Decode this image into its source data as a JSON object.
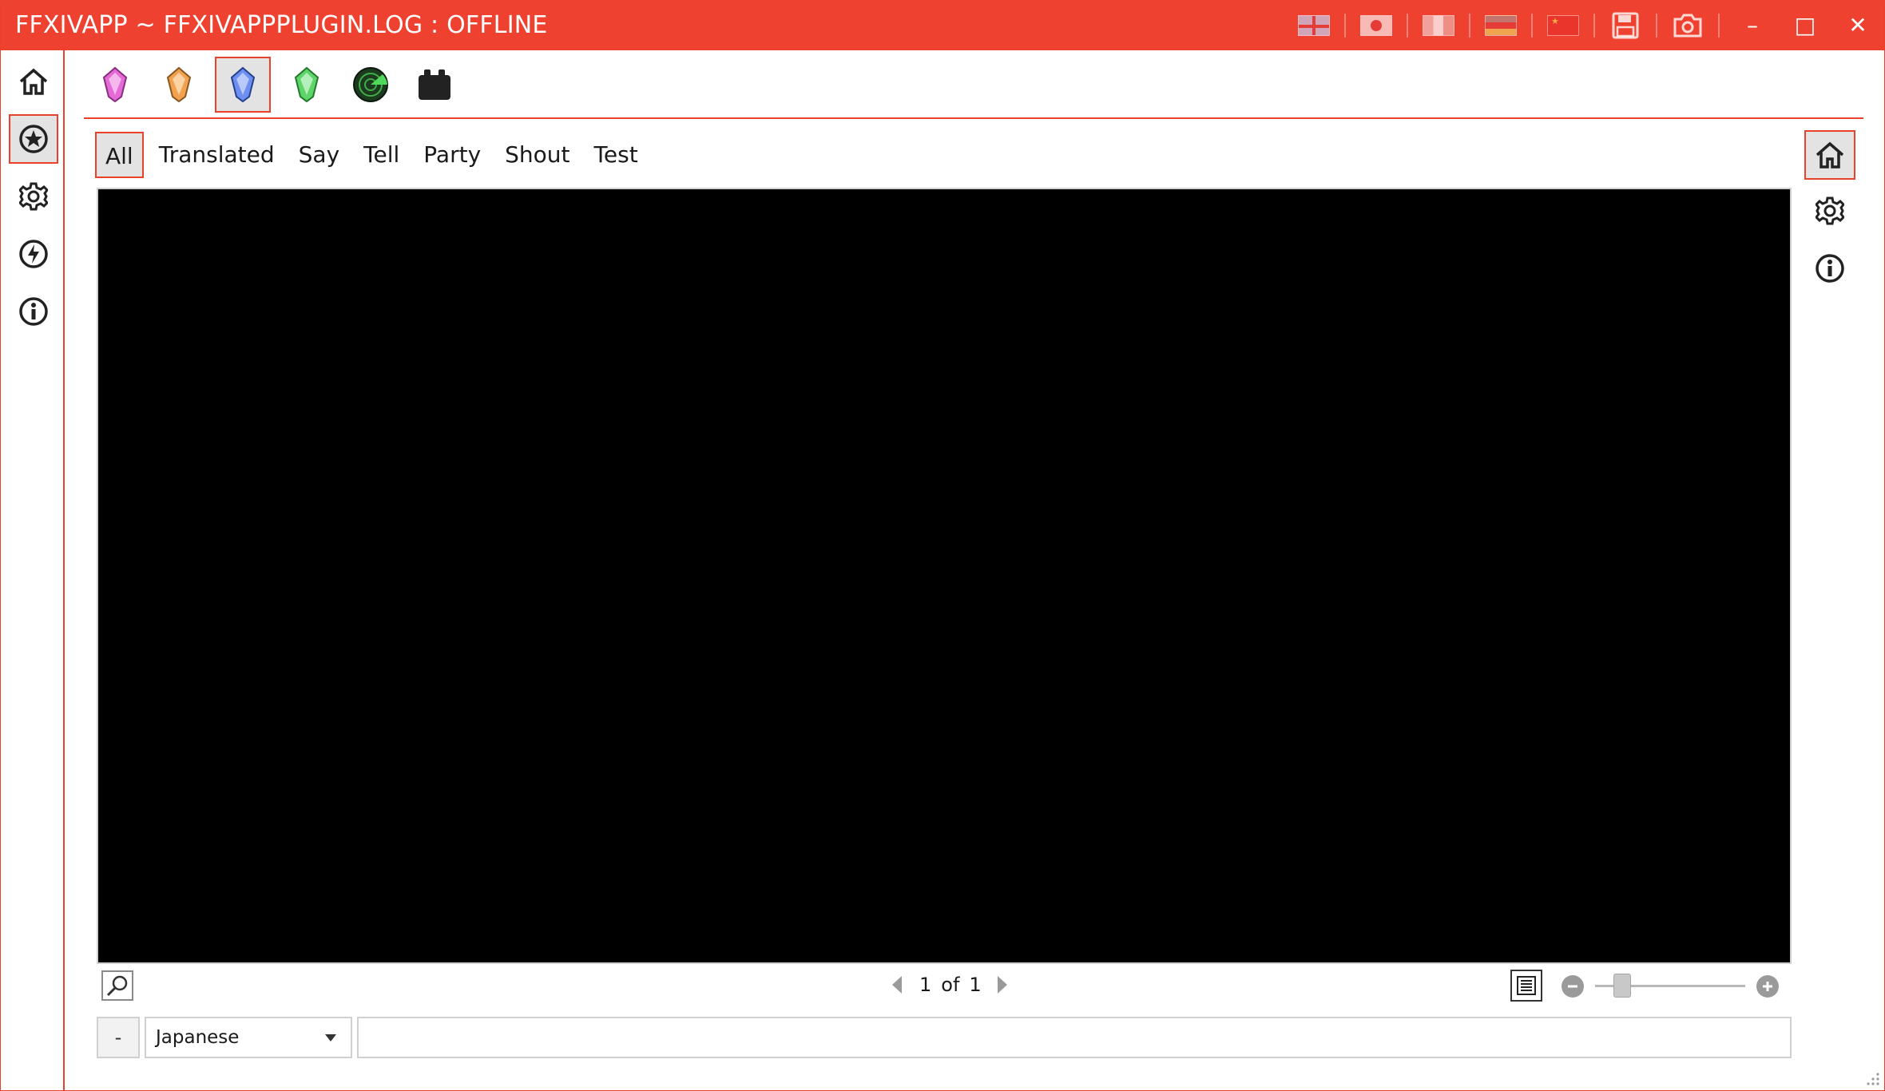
{
  "window": {
    "title": "FFXIVAPP ~ FFXIVAPPPLUGIN.LOG : OFFLINE",
    "accent": "#ee4130",
    "controls": {
      "minimize": "–",
      "maximize": "□",
      "close": "✕"
    },
    "icons": [
      "flag-en-icon",
      "flag-jp-icon",
      "flag-fr-icon",
      "flag-de-icon",
      "flag-cn-icon",
      "save-icon",
      "camera-icon"
    ]
  },
  "leftnav": {
    "icons": [
      "home-icon",
      "star-icon",
      "gear-icon",
      "update-icon",
      "info-icon"
    ],
    "active": "star-icon"
  },
  "plugins": {
    "icons": [
      "pink-crystal-icon",
      "orange-crystal-icon",
      "blue-crystal-icon",
      "green-crystal-icon",
      "radar-icon",
      "calendar-icon"
    ],
    "active": "blue-crystal-icon"
  },
  "tabs": [
    {
      "label": "All",
      "active": true
    },
    {
      "label": "Translated",
      "active": false
    },
    {
      "label": "Say",
      "active": false
    },
    {
      "label": "Tell",
      "active": false
    },
    {
      "label": "Party",
      "active": false
    },
    {
      "label": "Shout",
      "active": false
    },
    {
      "label": "Test",
      "active": false
    }
  ],
  "right_panel": {
    "icons": [
      "home-icon",
      "gear-icon",
      "info-icon"
    ],
    "active": "home-icon"
  },
  "log": {
    "background": "#000000"
  },
  "pager": {
    "current": "1",
    "of_label": "of",
    "total": "1"
  },
  "zoom": {
    "minus": "−",
    "plus": "+",
    "level": 0.18
  },
  "chat_input": {
    "minus_label": "-",
    "language": "Japanese",
    "value": "",
    "placeholder": ""
  }
}
